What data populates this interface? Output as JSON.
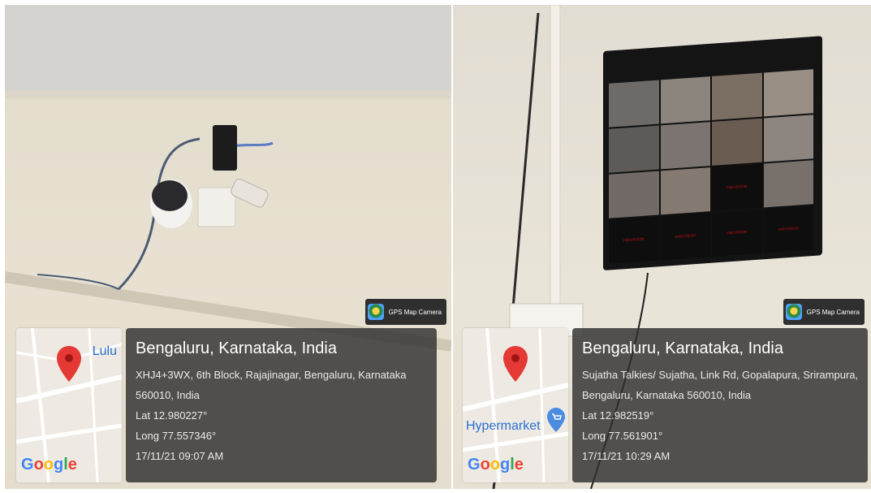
{
  "photos": [
    {
      "app_badge": "GPS Map Camera",
      "map_label": "Lulu",
      "map_brand": "Google",
      "city": "Bengaluru, Karnataka, India",
      "address_line1": "XHJ4+3WX, 6th Block, Rajajinagar, Bengaluru, Karnataka",
      "address_line2": "560010, India",
      "lat": "Lat 12.980227°",
      "long": "Long 77.557346°",
      "datetime": "17/11/21 09:07 AM"
    },
    {
      "app_badge": "GPS Map Camera",
      "map_label": "Hypermarket",
      "map_brand": "Google",
      "city": "Bengaluru, Karnataka, India",
      "address_line1": "Sujatha Talkies/ Sujatha, Link Rd, Gopalapura, Srirampura,",
      "address_line2": "Bengaluru, Karnataka 560010, India",
      "lat": "Lat 12.982519°",
      "long": "Long 77.561901°",
      "datetime": "17/11/21 10:29 AM"
    }
  ],
  "monitor": {
    "brand_tiles": [
      "HIKVISION",
      "HIKVISION",
      "HIKVISION",
      "HIKVISION",
      "HIKVISION",
      "HIKVISION"
    ]
  },
  "colors": {
    "panel_bg": "#303030",
    "pin_red": "#e53935",
    "map_text_blue": "#2a6fd1"
  }
}
